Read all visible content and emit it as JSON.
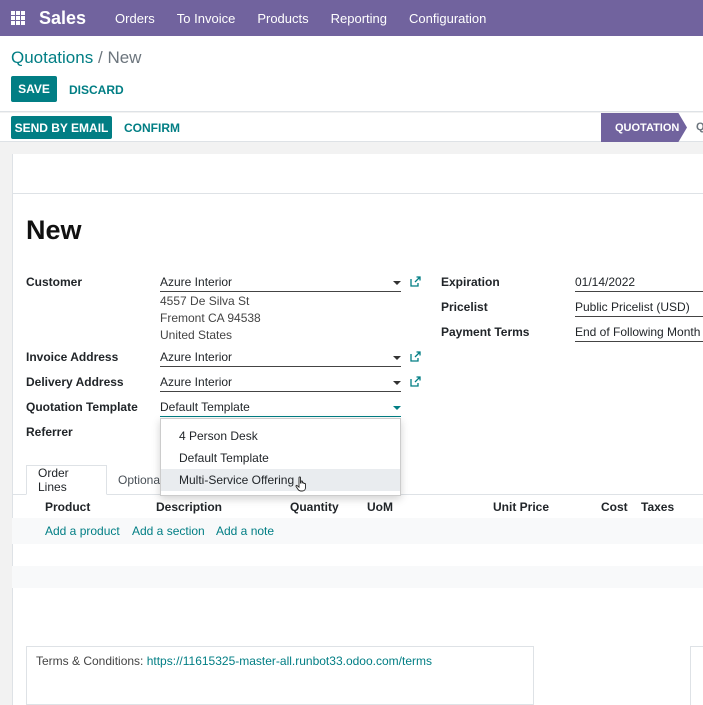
{
  "topbar": {
    "brand": "Sales",
    "menu": [
      "Orders",
      "To Invoice",
      "Products",
      "Reporting",
      "Configuration"
    ]
  },
  "breadcrumb": {
    "parent": "Quotations",
    "separator": "/",
    "current": "New"
  },
  "buttons": {
    "save": "SAVE",
    "discard": "DISCARD",
    "send_by_email": "SEND BY EMAIL",
    "confirm": "CONFIRM"
  },
  "status": {
    "active": "QUOTATION",
    "next": "Q"
  },
  "record": {
    "title": "New"
  },
  "fields": {
    "customer": {
      "label": "Customer",
      "value": "Azure Interior",
      "address": [
        "4557 De Silva St",
        "Fremont CA 94538",
        "United States"
      ]
    },
    "invoice_address": {
      "label": "Invoice Address",
      "value": "Azure Interior"
    },
    "delivery_address": {
      "label": "Delivery Address",
      "value": "Azure Interior"
    },
    "quotation_template": {
      "label": "Quotation Template",
      "value": "Default Template"
    },
    "referrer": {
      "label": "Referrer",
      "value": ""
    },
    "expiration": {
      "label": "Expiration",
      "value": "01/14/2022"
    },
    "pricelist": {
      "label": "Pricelist",
      "value": "Public Pricelist (USD)"
    },
    "payment_terms": {
      "label": "Payment Terms",
      "value": "End of Following Month"
    }
  },
  "template_dropdown": {
    "options": [
      "4 Person Desk",
      "Default Template",
      "Multi-Service Offering"
    ],
    "hovered": "Multi-Service Offering"
  },
  "tabs": [
    "Order Lines",
    "Optiona"
  ],
  "columns": [
    "Product",
    "Description",
    "Quantity",
    "UoM",
    "Unit Price",
    "Cost",
    "Taxes"
  ],
  "list_actions": [
    "Add a product",
    "Add a section",
    "Add a note"
  ],
  "terms": {
    "label": "Terms & Conditions:",
    "url": "https://11615325-master-all.runbot33.odoo.com/terms"
  },
  "colors": {
    "brand": "#71639e",
    "primary": "#017e84"
  }
}
